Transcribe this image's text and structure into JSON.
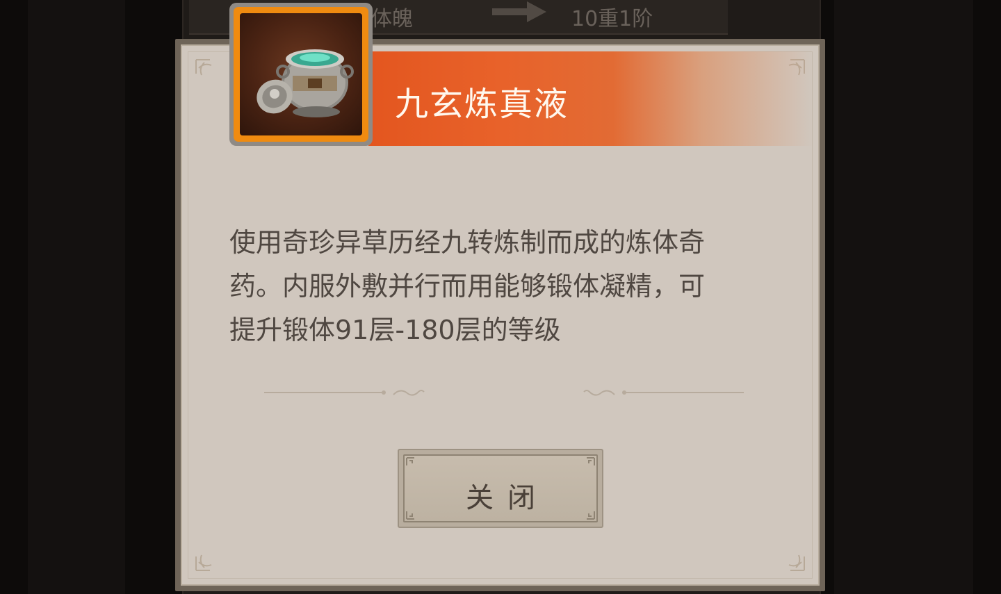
{
  "background": {
    "row_label": "体魄",
    "row_value": "10重1阶",
    "arrow_icon": "right-arrow-icon"
  },
  "item": {
    "name": "九玄炼真液",
    "icon": "cauldron-icon",
    "frame_color": "#f08b10",
    "description_lines": [
      "使用奇珍异草历经九转炼制而成的炼体奇",
      "药。内服外敷并行而用能够锻体凝精，可",
      "提升锻体91层-180层的等级"
    ]
  },
  "buttons": {
    "close_label": "关闭"
  },
  "colors": {
    "title_banner": "#e3561f",
    "panel": "#d0c7be",
    "text": "#4f4741"
  }
}
